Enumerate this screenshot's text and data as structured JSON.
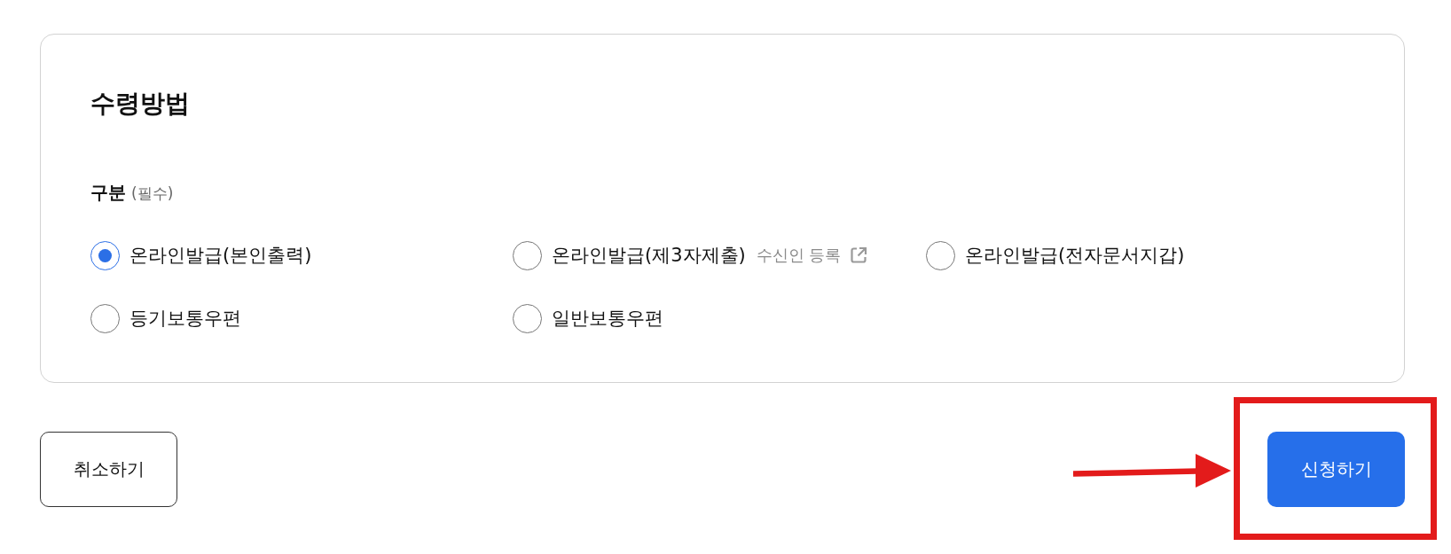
{
  "section": {
    "title": "수령방법"
  },
  "field": {
    "label": "구분",
    "note": "(필수)"
  },
  "options": [
    {
      "label": "온라인발급(본인출력)",
      "selected": true
    },
    {
      "label": "온라인발급(제3자제출)",
      "selected": false,
      "link": "수신인 등록"
    },
    {
      "label": "온라인발급(전자문서지갑)",
      "selected": false
    },
    {
      "label": "등기보통우편",
      "selected": false
    },
    {
      "label": "일반보통우편",
      "selected": false
    }
  ],
  "buttons": [
    {
      "label": "취소하기",
      "kind": "secondary"
    },
    {
      "label": "신청하기",
      "kind": "primary"
    }
  ]
}
